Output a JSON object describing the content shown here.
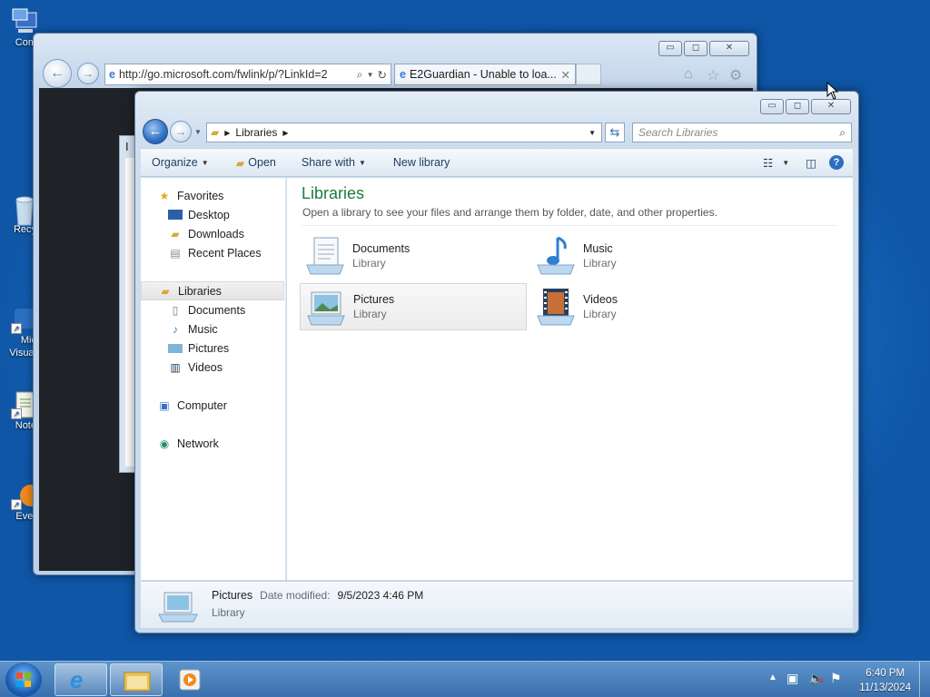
{
  "desktop": {
    "icons": [
      {
        "label": "Com",
        "icon": "computer-icon"
      },
      {
        "label": "Recy",
        "icon": "recycle-bin-icon"
      },
      {
        "label": "Mic",
        "label2": "Visual",
        "icon": "app-shortcut-icon"
      },
      {
        "label": "Note",
        "icon": "notepad-icon"
      },
      {
        "label": "Ever",
        "icon": "everything-icon"
      }
    ]
  },
  "browser": {
    "address": "http://go.microsoft.com/fwlink/p/?LinkId=2",
    "tab_title": "E2Guardian - Unable to loa...",
    "dialog_title": "I"
  },
  "explorer": {
    "breadcrumb": [
      "Libraries"
    ],
    "search_placeholder": "Search Libraries",
    "toolbar": {
      "organize": "Organize",
      "open": "Open",
      "share_with": "Share with",
      "new_library": "New library"
    },
    "nav": {
      "favorites": "Favorites",
      "favorite_items": [
        "Desktop",
        "Downloads",
        "Recent Places"
      ],
      "libraries": "Libraries",
      "library_items": [
        "Documents",
        "Music",
        "Pictures",
        "Videos"
      ],
      "computer": "Computer",
      "network": "Network"
    },
    "content": {
      "title": "Libraries",
      "description": "Open a library to see your files and arrange them by folder, date, and other properties.",
      "libraries": [
        {
          "name": "Documents",
          "type": "Library"
        },
        {
          "name": "Music",
          "type": "Library"
        },
        {
          "name": "Pictures",
          "type": "Library",
          "selected": true
        },
        {
          "name": "Videos",
          "type": "Library"
        }
      ]
    },
    "details": {
      "name": "Pictures",
      "modified_label": "Date modified:",
      "modified_value": "9/5/2023 4:46 PM",
      "type": "Library"
    }
  },
  "taskbar": {
    "time": "6:40 PM",
    "date": "11/13/2024"
  },
  "colors": {
    "library_title": "#1e7a3c",
    "desktop": "#1a6cc0"
  }
}
